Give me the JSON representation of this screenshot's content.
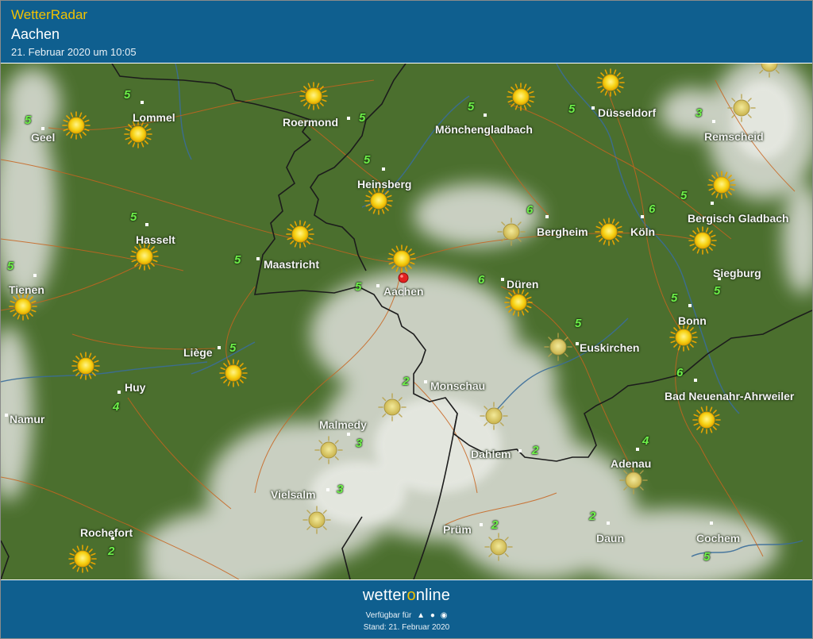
{
  "header": {
    "brand": "WetterRadar",
    "location": "Aachen",
    "timestamp": "21. Februar 2020 um 10:05"
  },
  "footer": {
    "logo_left": "wetter",
    "logo_o": "o",
    "logo_right": "nline",
    "available_label": "Verfügbar für",
    "platform_icons": [
      "android-icon",
      "apple-icon",
      "web-icon"
    ],
    "stand": "Stand: 21. Februar 2020"
  },
  "map": {
    "cities": [
      "Geel",
      "Lommel",
      "Roermond",
      "Mönchengladbach",
      "Düsseldorf",
      "Remscheid",
      "Heinsberg",
      "Hasselt",
      "Maastricht",
      "Bergheim",
      "Köln",
      "Bergisch Gladbach",
      "Tienen",
      "Aachen",
      "Düren",
      "Siegburg",
      "Bonn",
      "Liège",
      "Euskirchen",
      "Huy",
      "Bad Neuenahr-Ahrweiler",
      "Namur",
      "Monschau",
      "Malmedy",
      "Dahlem",
      "Adenau",
      "Vielsalm",
      "Rochefort",
      "Prüm",
      "Daun",
      "Cochem"
    ],
    "wind_values": [
      "5",
      "5",
      "5",
      "5",
      "5",
      "3",
      "5",
      "5",
      "5",
      "6",
      "6",
      "5",
      "5",
      "5",
      "6",
      "5",
      "5",
      "5",
      "5",
      "4",
      "6",
      "2",
      "3",
      "2",
      "4",
      "3",
      "2",
      "2",
      "2",
      "5"
    ],
    "marker_city": "Aachen"
  },
  "colors": {
    "header_bg": "#0f5f8f",
    "brand_yellow": "#f2c200",
    "land_green": "#496e2c",
    "wind_green": "#5fe03f",
    "sun_yellow": "#f7d417"
  }
}
